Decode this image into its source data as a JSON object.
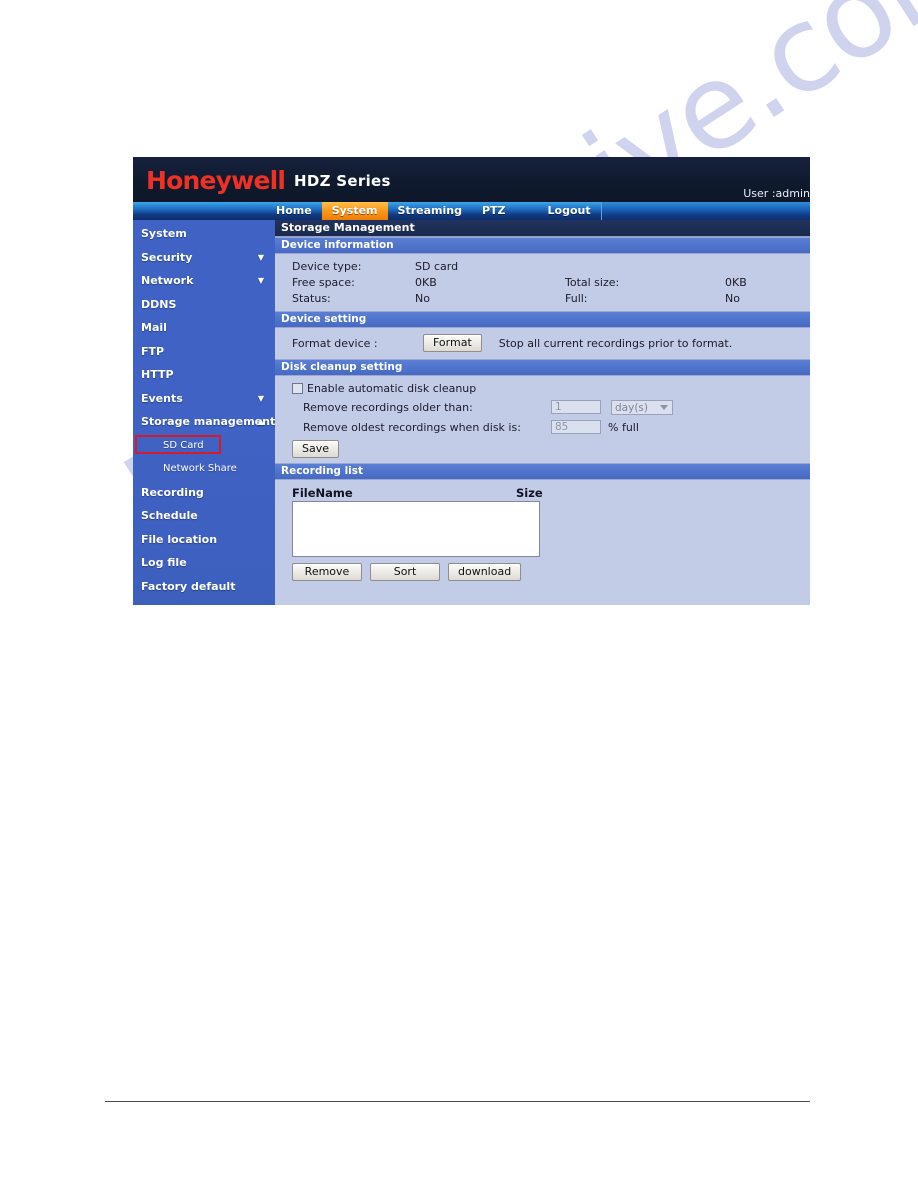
{
  "watermark": {
    "text": "manualshive.com"
  },
  "header": {
    "logo": "Honeywell",
    "series": "HDZ Series",
    "user": "User :admin"
  },
  "nav": {
    "items": [
      {
        "label": "Home",
        "active": false
      },
      {
        "label": "System",
        "active": true
      },
      {
        "label": "Streaming",
        "active": false
      },
      {
        "label": "PTZ",
        "active": false
      },
      {
        "label": "Logout",
        "active": false
      }
    ],
    "active_color": "#f4900d",
    "bar_color": "#1f6fc4"
  },
  "sidebar": {
    "items": [
      {
        "label": "System",
        "arrow": ""
      },
      {
        "label": "Security",
        "arrow": "▼"
      },
      {
        "label": "Network",
        "arrow": "▼"
      },
      {
        "label": "DDNS",
        "arrow": ""
      },
      {
        "label": "Mail",
        "arrow": ""
      },
      {
        "label": "FTP",
        "arrow": ""
      },
      {
        "label": "HTTP",
        "arrow": ""
      },
      {
        "label": "Events",
        "arrow": "▼"
      },
      {
        "label": "Storage management",
        "arrow": "▲"
      }
    ],
    "subitems": [
      {
        "label": "SD Card",
        "highlighted": true
      },
      {
        "label": "Network Share",
        "highlighted": false
      }
    ],
    "items_after": [
      {
        "label": "Recording",
        "arrow": ""
      },
      {
        "label": "Schedule",
        "arrow": ""
      },
      {
        "label": "File location",
        "arrow": ""
      },
      {
        "label": "Log file",
        "arrow": ""
      },
      {
        "label": "Factory default",
        "arrow": ""
      }
    ],
    "highlight_color": "#d8192c",
    "background_color": "#3f62c4"
  },
  "content": {
    "title": "Storage Management",
    "device_information": {
      "heading": "Device information",
      "rows": [
        {
          "label": "Device type:",
          "value": "SD card",
          "label2": "",
          "value2": ""
        },
        {
          "label": "Free space:",
          "value": "0KB",
          "label2": "Total size:",
          "value2": "0KB"
        },
        {
          "label": "Status:",
          "value": "No",
          "label2": "Full:",
          "value2": "No"
        }
      ]
    },
    "device_setting": {
      "heading": "Device setting",
      "format_label": "Format device :",
      "format_button": "Format",
      "note": "Stop all current recordings prior to format."
    },
    "disk_cleanup": {
      "heading": "Disk cleanup setting",
      "enable_label": "Enable automatic disk cleanup",
      "enable_checked": false,
      "older_than_label": "Remove recordings older than:",
      "older_than_value": "1",
      "unit_value": "day(s)",
      "disk_full_label": "Remove oldest recordings when disk is:",
      "disk_full_value": "85",
      "percent_label": "% full",
      "save_button": "Save"
    },
    "recording_list": {
      "heading": "Recording list",
      "col_filename": "FileName",
      "col_size": "Size",
      "files": [],
      "buttons": [
        {
          "label": "Remove"
        },
        {
          "label": "Sort"
        },
        {
          "label": "download"
        }
      ]
    }
  }
}
